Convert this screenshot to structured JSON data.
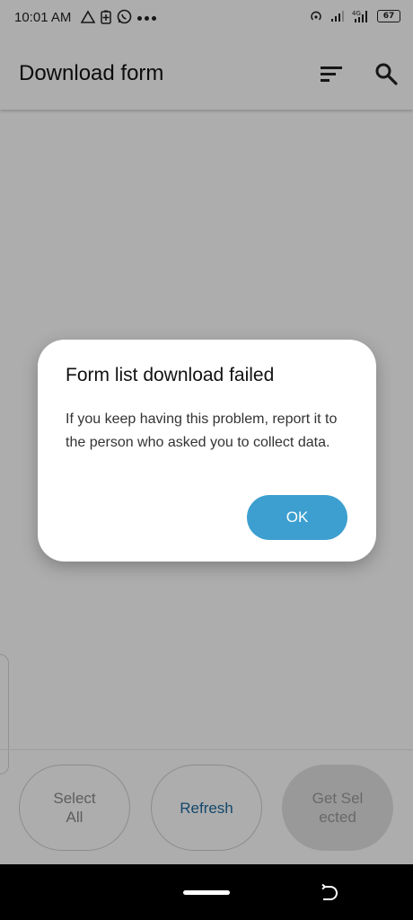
{
  "status_bar": {
    "time": "10:01 AM",
    "battery": "67",
    "icons_left": [
      "alert-triangle-icon",
      "battery-saver-icon",
      "whatsapp-icon",
      "more-dots-icon"
    ],
    "icons_right": [
      "hotspot-icon",
      "signal-icon",
      "4g-signal-icon",
      "battery-icon"
    ]
  },
  "toolbar": {
    "title": "Download form",
    "sort_icon": "sort-icon",
    "search_icon": "search-icon"
  },
  "buttons": {
    "select_all": "Select All",
    "refresh": "Refresh",
    "get_selected": "Get Selected"
  },
  "dialog": {
    "title": "Form list download failed",
    "message": "If you keep having this problem, report it to the person who asked you to collect data.",
    "ok": "OK"
  },
  "colors": {
    "accent": "#3d9fcf",
    "refresh_text": "#1e6aa0"
  }
}
